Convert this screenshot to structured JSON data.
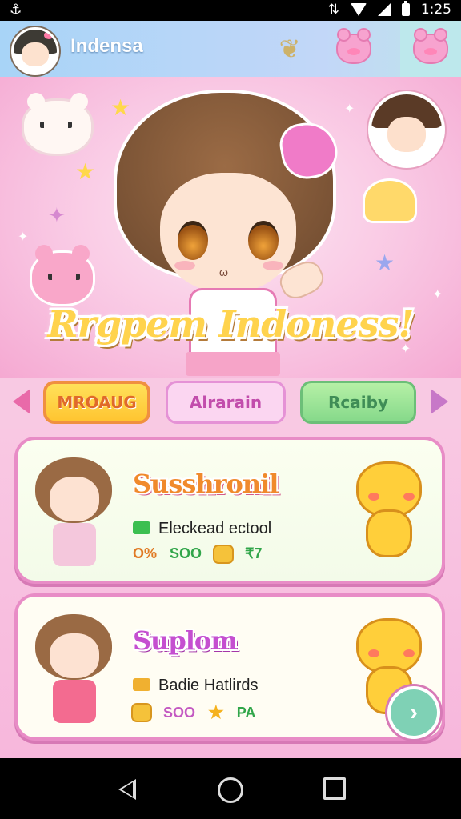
{
  "status_bar": {
    "time": "1:25",
    "left_icon": "anchor-icon",
    "right_icons": [
      "data-icon",
      "wifi-icon",
      "signal-icon",
      "battery-icon"
    ]
  },
  "app_bar": {
    "title": "Indensa",
    "actions": [
      "butterfly-icon",
      "pink-bear-icon",
      "pink-bear-icon"
    ]
  },
  "hero": {
    "headline": "Rrgpem Indoness!"
  },
  "tabs": [
    {
      "label": "MROAUG",
      "color": "#ffd34d"
    },
    {
      "label": "Alrarain",
      "color": "#fbd6f1"
    },
    {
      "label": "Rcaiby",
      "color": "#9fe59a"
    }
  ],
  "cards": [
    {
      "title": "Susshronil",
      "subtitle": "Eleckead ectool",
      "stats": [
        "O%",
        "SOO",
        "₹7"
      ]
    },
    {
      "title": "Suplom",
      "subtitle": "Badie Hatlirds",
      "stats": [
        "SOO",
        "PA"
      ]
    }
  ],
  "fab": {
    "icon": "arrow-right-icon",
    "glyph": "›"
  },
  "nav_bar": [
    "back-icon",
    "home-icon",
    "recent-apps-icon"
  ],
  "colors": {
    "accent_pink": "#f5a9d2",
    "header_blue": "#a8d4f7",
    "card_border": "#e88cc6"
  }
}
